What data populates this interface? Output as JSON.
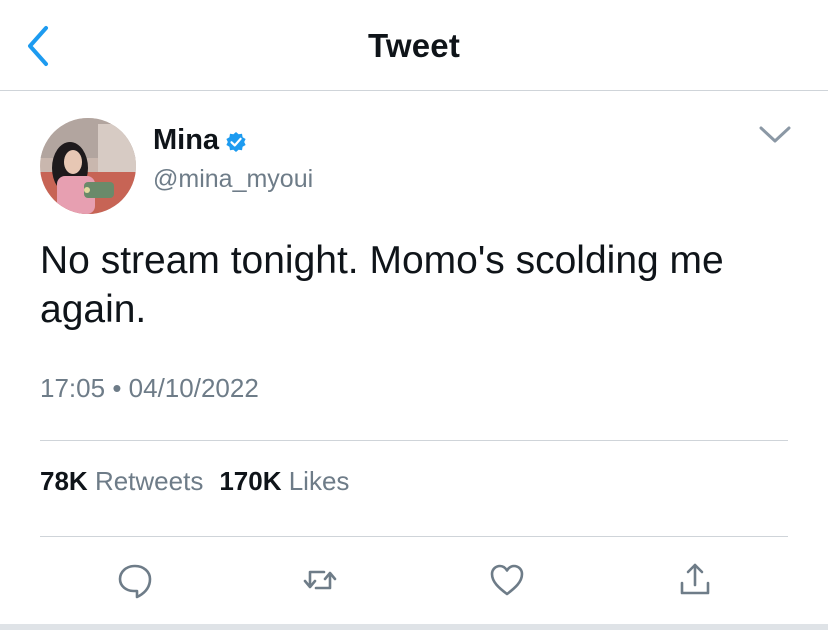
{
  "header": {
    "title": "Tweet",
    "back_icon": "chevron-left-icon",
    "accent": "#1d9bf0"
  },
  "author": {
    "name": "Mina",
    "handle": "@mina_myoui",
    "verified_icon": "verified-badge-icon"
  },
  "tweet": {
    "text": "No stream tonight. Momo's scolding me again.",
    "time": "17:05",
    "separator": "•",
    "date": "04/10/2022"
  },
  "stats": {
    "retweets_count": "78K",
    "retweets_label": "Retweets",
    "likes_count": "170K",
    "likes_label": "Likes"
  },
  "actions": [
    "reply-icon",
    "retweet-icon",
    "like-icon",
    "share-icon"
  ],
  "colors": {
    "text": "#0f1419",
    "secondary": "#6e7c88",
    "divider": "#cfd4d9",
    "icon": "#6e7c88"
  }
}
